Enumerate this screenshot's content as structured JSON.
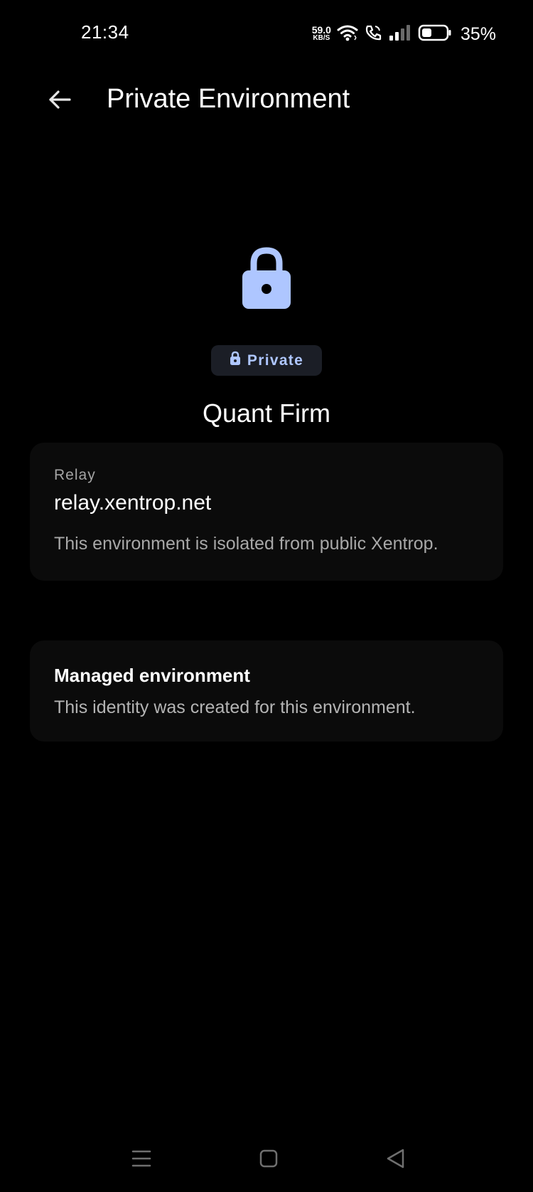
{
  "status_bar": {
    "time": "21:34",
    "net_speed_value": "59.0",
    "net_speed_unit": "KB/S",
    "battery_percent": "35%",
    "battery_level": 0.35
  },
  "header": {
    "title": "Private Environment"
  },
  "hero": {
    "badge_label": "Private",
    "org_name": "Quant Firm"
  },
  "relay_card": {
    "label": "Relay",
    "value": "relay.xentrop.net",
    "description": "This environment is isolated from public Xentrop."
  },
  "managed_card": {
    "title": "Managed environment",
    "description": "This identity was created for this environment."
  },
  "colors": {
    "background": "#000000",
    "accent": "#aec6ff",
    "card_background": "#0b0b0b",
    "badge_background": "#1b1e26"
  },
  "icons": {
    "back": "arrow-left-icon",
    "hero": "lock-icon",
    "badge": "lock-icon",
    "nav_menu": "menu-icon",
    "nav_home": "square-icon",
    "nav_back": "triangle-back-icon"
  }
}
